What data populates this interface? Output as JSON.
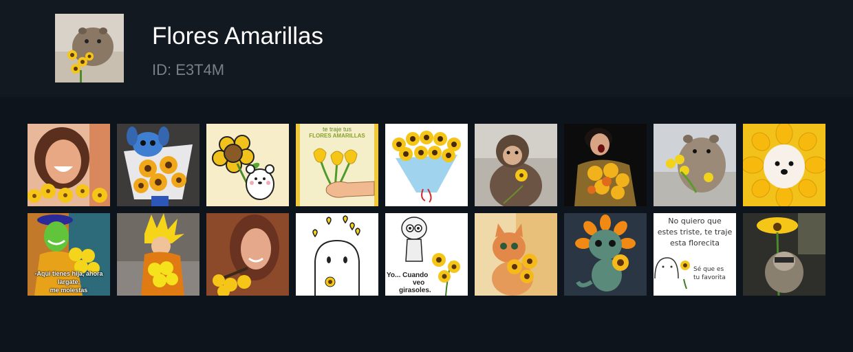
{
  "pack": {
    "title": "Flores Amarillas",
    "id_text": "ID: E3T4M"
  },
  "stickers": [
    {
      "icon": "smiling-woman-sunflowers"
    },
    {
      "icon": "stitch-bouquet"
    },
    {
      "icon": "bear-sunflower"
    },
    {
      "icon": "hand-yellow-tulips",
      "caption_lines": [
        "te traje tus",
        "FLORES AMARILLAS"
      ]
    },
    {
      "icon": "sunflower-bouquet"
    },
    {
      "icon": "monkey-sunflower"
    },
    {
      "icon": "laughing-woman-bouquet"
    },
    {
      "icon": "hamster-yellow-flowers"
    },
    {
      "icon": "dog-sunflower-costume"
    },
    {
      "icon": "mask-man-flowers",
      "caption_lines": [
        "-Aqui tienes hija, ahora largate,",
        "me molestas"
      ]
    },
    {
      "icon": "goku-bouquet"
    },
    {
      "icon": "woman-sunflowers"
    },
    {
      "icon": "flork-sunflower"
    },
    {
      "icon": "cartoon-girl-sunflowers",
      "caption_lines": [
        "Yo... Cuando",
        "veo",
        "girasoles."
      ]
    },
    {
      "icon": "cat-sunflowers"
    },
    {
      "icon": "dinosaur-sunflower"
    },
    {
      "icon": "sad-doodle-sunflower",
      "caption_lines": [
        "No quiero que",
        "estes triste, te traje",
        "esta florecita"
      ],
      "side_lines": [
        "Sé que es",
        "tu favorita"
      ]
    },
    {
      "icon": "raccoon-sunflower"
    }
  ],
  "colors": {
    "background": "#0e141b",
    "header": "#121921",
    "sunflower": "#f5c518",
    "subtext": "#7b7f86"
  }
}
